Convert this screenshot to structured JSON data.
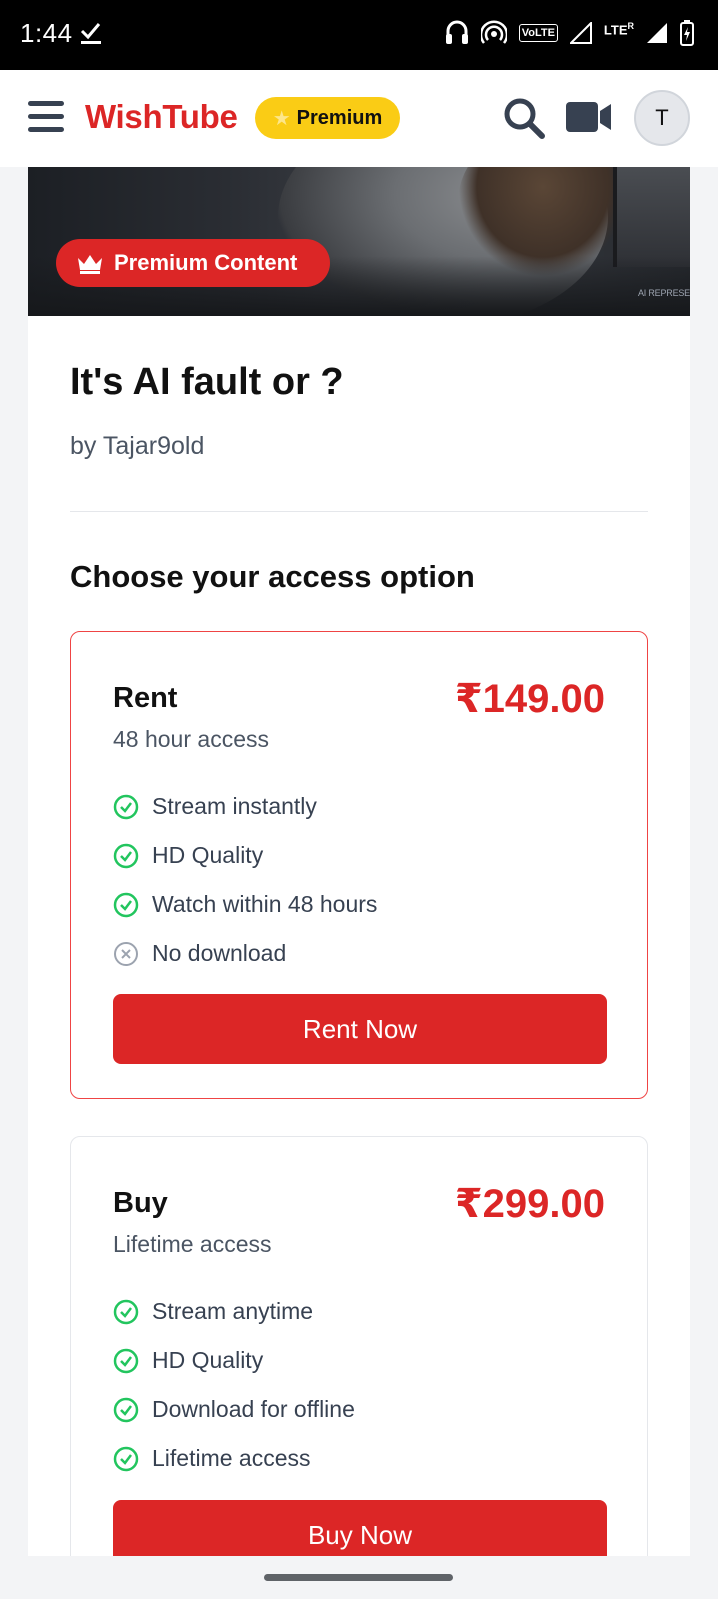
{
  "status_bar": {
    "time": "1:44",
    "network_type": "LTE",
    "network_badge": "VoLTE",
    "roaming": "R"
  },
  "header": {
    "brand": "WishTube",
    "premium_label": "Premium",
    "avatar_initial": "T"
  },
  "hero": {
    "badge_label": "Premium Content",
    "watermark": "AI REPRESE"
  },
  "content": {
    "title": "It's AI fault or ?",
    "author": "by Tajar9old",
    "section_heading": "Choose your access option"
  },
  "options": [
    {
      "name": "Rent",
      "price": "₹149.00",
      "subtitle": "48 hour access",
      "features": [
        {
          "label": "Stream instantly",
          "included": true
        },
        {
          "label": "HD Quality",
          "included": true
        },
        {
          "label": "Watch within 48 hours",
          "included": true
        },
        {
          "label": "No download",
          "included": false
        }
      ],
      "button_label": "Rent Now"
    },
    {
      "name": "Buy",
      "price": "₹299.00",
      "subtitle": "Lifetime access",
      "features": [
        {
          "label": "Stream anytime",
          "included": true
        },
        {
          "label": "HD Quality",
          "included": true
        },
        {
          "label": "Download for offline",
          "included": true
        },
        {
          "label": "Lifetime access",
          "included": true
        }
      ],
      "button_label": "Buy Now"
    }
  ],
  "colors": {
    "brand": "#dc2626",
    "premium_pill": "#facc15",
    "check": "#22c55e",
    "excluded": "#9ca3af"
  }
}
